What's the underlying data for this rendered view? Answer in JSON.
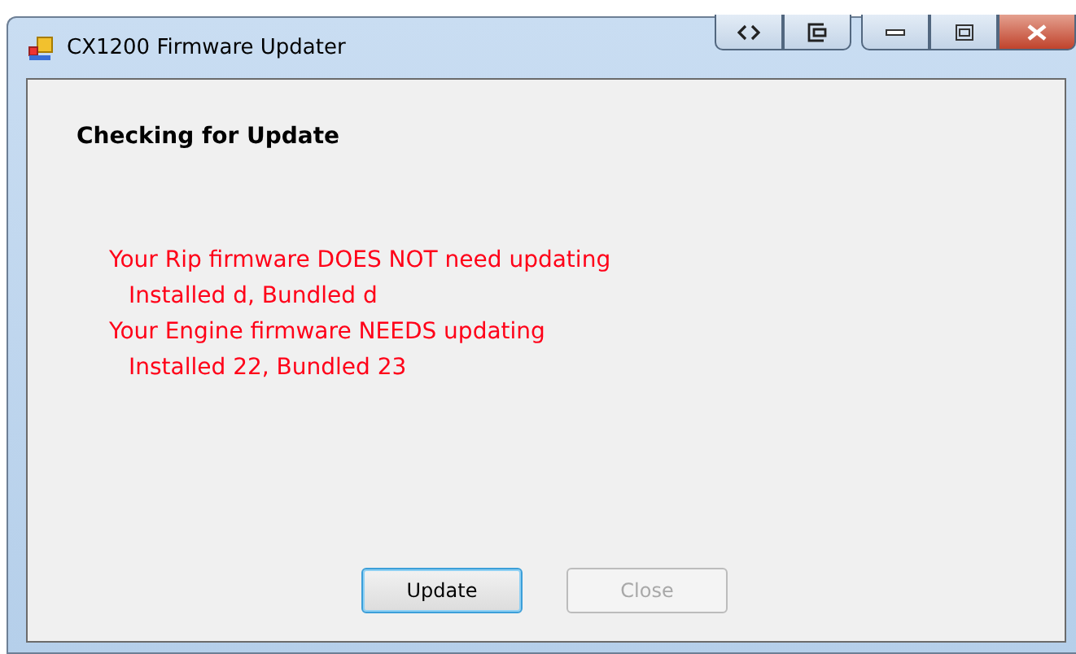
{
  "window": {
    "title": "CX1200 Firmware Updater"
  },
  "caption_buttons": [
    {
      "kind": "code"
    },
    {
      "kind": "export"
    },
    {
      "kind": "minimize"
    },
    {
      "kind": "maximize"
    },
    {
      "kind": "close"
    }
  ],
  "heading": "Checking for Update",
  "messages": [
    {
      "text": "Your Rip firmware DOES NOT need updating",
      "children": [
        {
          "text": "Installed d, Bundled d"
        }
      ]
    },
    {
      "text": "Your Engine firmware NEEDS updating",
      "children": [
        {
          "text": "Installed 22, Bundled 23"
        }
      ]
    }
  ],
  "buttons": [
    {
      "label": "Update",
      "disabled": false,
      "focused": true
    },
    {
      "label": "Close",
      "disabled": true,
      "focused": false
    }
  ]
}
